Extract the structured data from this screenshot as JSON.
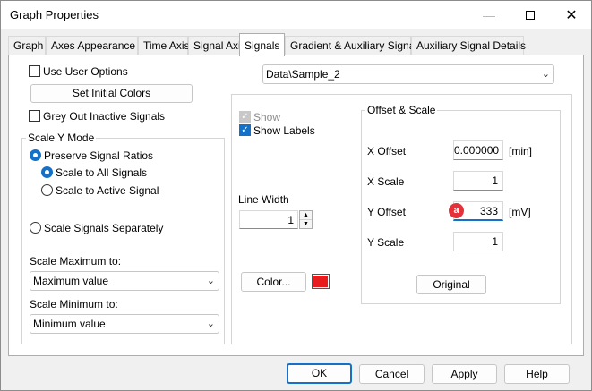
{
  "window": {
    "title": "Graph Properties",
    "minimize_icon": "minimize-icon",
    "maximize_icon": "maximize-icon",
    "close_icon": "close-icon"
  },
  "tabs": [
    {
      "label": "Graph"
    },
    {
      "label": "Axes Appearance"
    },
    {
      "label": "Time Axis"
    },
    {
      "label": "Signal Axis"
    },
    {
      "label": "Signals",
      "active": true
    },
    {
      "label": "Gradient & Auxiliary Signals"
    },
    {
      "label": "Auxiliary Signal Details"
    }
  ],
  "left": {
    "use_user_options": {
      "label": "Use User Options",
      "checked": false
    },
    "set_initial_colors": "Set Initial Colors",
    "grey_out": {
      "label": "Grey Out Inactive Signals",
      "checked": false
    },
    "scale_y_mode": {
      "title": "Scale Y Mode",
      "preserve": {
        "label": "Preserve Signal Ratios",
        "selected": true
      },
      "scale_all": {
        "label": "Scale to All Signals",
        "selected": true
      },
      "scale_active": {
        "label": "Scale to Active Signal",
        "selected": false
      },
      "separately": {
        "label": "Scale Signals Separately",
        "selected": false
      },
      "max_label": "Scale Maximum to:",
      "max_value": "Maximum value",
      "min_label": "Scale Minimum to:",
      "min_value": "Minimum value"
    }
  },
  "signal_select": {
    "value": "Data\\Sample_2"
  },
  "right": {
    "show": {
      "label": "Show",
      "checked": true,
      "disabled": true
    },
    "show_labels": {
      "label": "Show Labels",
      "checked": true
    },
    "line_width": {
      "label": "Line Width",
      "value": "1"
    },
    "color_button": "Color...",
    "color_swatch": "#e81c1c",
    "offset_scale": {
      "title": "Offset & Scale",
      "x_offset": {
        "label": "X Offset",
        "value": "0.000000",
        "unit": "[min]"
      },
      "x_scale": {
        "label": "X Scale",
        "value": "1"
      },
      "y_offset": {
        "label": "Y Offset",
        "value": "333",
        "unit": "[mV]",
        "marker": "a"
      },
      "y_scale": {
        "label": "Y Scale",
        "value": "1"
      },
      "original_button": "Original"
    }
  },
  "footer": {
    "ok": "OK",
    "cancel": "Cancel",
    "apply": "Apply",
    "help": "Help"
  },
  "colors": {
    "accent": "#1570c7",
    "marker": "#e5323a"
  }
}
